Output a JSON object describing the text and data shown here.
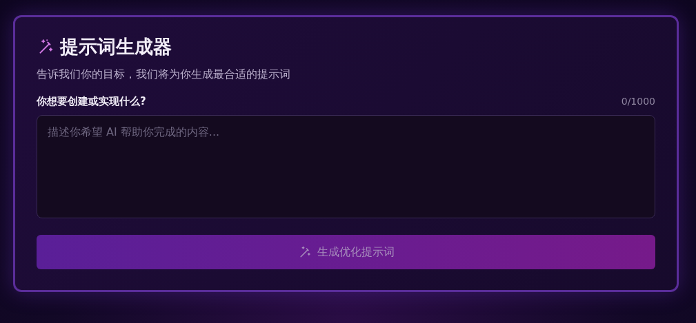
{
  "title": "提示词生成器",
  "subtitle": "告诉我们你的目标，我们将为你生成最合适的提示词",
  "field": {
    "label": "你想要创建或实现什么?",
    "counter": "0/1000",
    "placeholder": "描述你希望 AI 帮助你完成的内容..."
  },
  "button": {
    "label": "生成优化提示词",
    "disabled": true
  }
}
